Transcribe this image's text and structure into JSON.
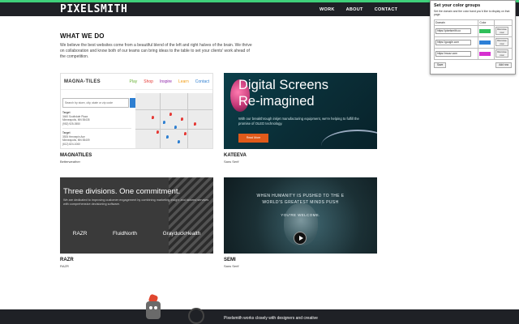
{
  "header": {
    "logo": "PIXELSMITH",
    "nav": [
      "WORK",
      "ABOUT",
      "CONTACT"
    ]
  },
  "section": {
    "title": "WHAT WE DO",
    "intro": "We believe the best websites come from a beautiful blend of the left and right halves of the brain. We thrive on collaboration and know both of our teams can bring ideas to the table to set your clients' work ahead of the competition."
  },
  "cards": [
    {
      "title": "MAGNATILES",
      "subtitle": "Betterweather",
      "thumb": {
        "logo": "MAGNA-TILES",
        "links": [
          "Play",
          "Shop",
          "Inspire",
          "Learn",
          "Contact"
        ],
        "link_colors": [
          "#6bb33a",
          "#e53935",
          "#8e24aa",
          "#f39c12",
          "#2e7fd1"
        ],
        "search_placeholder": "Search by store, city, state or zip code",
        "list": [
          [
            "Target",
            "3460 Southdale Plaza",
            "Minneapolis, MN 55435",
            "(952) 925-0550"
          ],
          [
            "Target",
            "3925 Hennepin Ave",
            "Minneapolis, MN 55409",
            "(612) 824-1060"
          ]
        ]
      }
    },
    {
      "title": "KATEEVA",
      "subtitle": "Sans Serif",
      "thumb": {
        "headline_1": "Digital Screens",
        "headline_2": "Re-imagined",
        "body": "With our breakthrough inkjet manufacturing equipment, we're helping to fulfill the promise of OLED technology.",
        "button": "Read More"
      }
    },
    {
      "title": "RAZR",
      "subtitle": "RAZR",
      "thumb": {
        "headline": "Three divisions. One commitment.",
        "body": "We are dedicated to improving customer engagement by combining marketing insight and tailored services with comprehensive decisioning software.",
        "brands": [
          "RAZR",
          "FluidNorth",
          "GrayduckHealth"
        ]
      }
    },
    {
      "title": "SEMI",
      "subtitle": "Sans Serif",
      "thumb": {
        "line_1": "WHEN HUMANITY IS PUSHED TO THE E",
        "line_2": "WORLD'S GREATEST MINDS PUSH",
        "line_3": "YOU'RE WELCOME."
      }
    }
  ],
  "footer": {
    "text": "Pixelsmith works closely with designers and creative"
  },
  "popup": {
    "title": "Set your color groups",
    "description": "Set the domain and the color band you'd like to display on that page.",
    "col_domain": "Domain",
    "col_color": "Color",
    "rows": [
      {
        "domain": "https://pixelsmith.co",
        "color": "#2fbf5a",
        "remove": "Remove row"
      },
      {
        "domain": "https://google.com",
        "color": "#2d7fd6",
        "remove": "Remove row"
      },
      {
        "domain": "https://mozz.com",
        "color": "#d62fd0",
        "remove": "Remove row"
      }
    ],
    "save": "Save",
    "add": "Add row"
  }
}
